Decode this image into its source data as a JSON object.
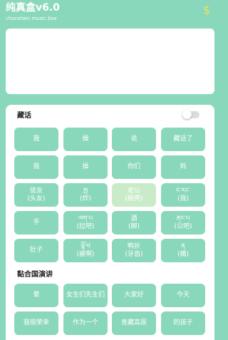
{
  "header": {
    "title": "纯真盒v6.0",
    "subtitle": "chunzhen music box",
    "dollar_icon": "$"
  },
  "colors": {
    "accent": "#8ad8bc",
    "accent_light": "#c9ebc7",
    "dollar": "#f3e05a",
    "card": "#ffffff"
  },
  "section1": {
    "title": "藏话",
    "toggle_on": false,
    "rows": [
      [
        "我",
        "操",
        "说",
        "藏话了"
      ],
      [
        "我",
        "操",
        "你们",
        "妈"
      ],
      [
        "徒友\n(头友)",
        "སྤ\n(炸)",
        "老公\n(脑壳)",
        "ང་རང་\n(我)"
      ],
      [
        "手",
        "ལག་པ\n(拉吧)",
        "酒\n(脚)",
        "རྐང་པ\n(公吧)"
      ],
      [
        "肚子",
        "ལྟོ་བ\n(被啊)",
        "鸭折\n(牙齿)",
        "ན\n(痛)"
      ]
    ]
  },
  "section2": {
    "title": "黏合国演讲",
    "rows": [
      [
        "晕",
        "女生们先生们",
        "大家好",
        "今天"
      ],
      [
        "我很荣幸",
        "作为一个",
        "青藏高原",
        "的孩子"
      ]
    ]
  }
}
